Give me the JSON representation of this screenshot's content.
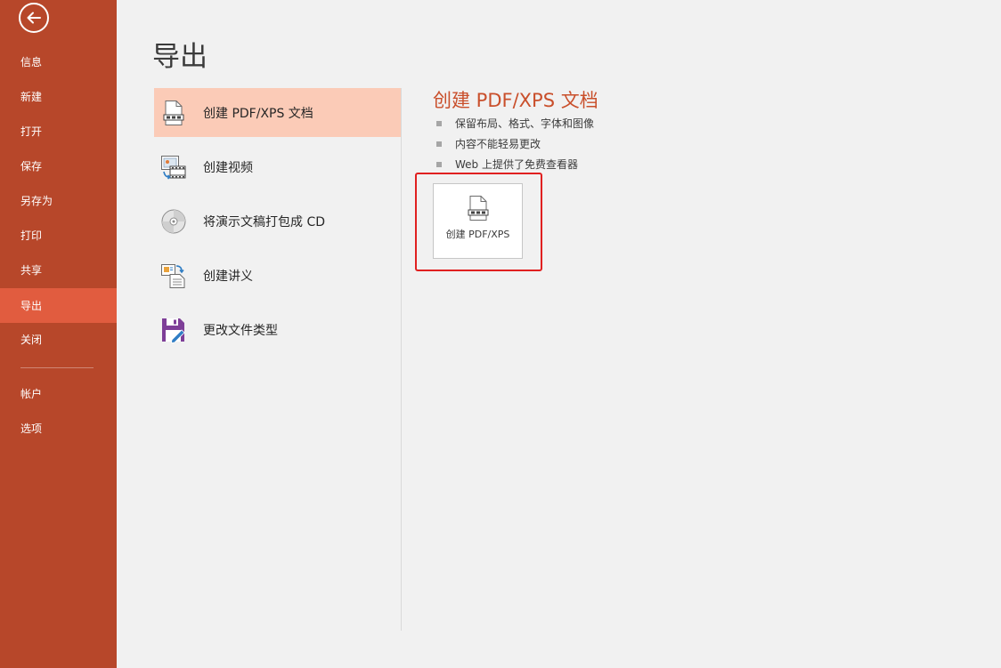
{
  "sidebar": {
    "back_icon": "back-arrow-icon",
    "items": [
      {
        "label": "信息"
      },
      {
        "label": "新建"
      },
      {
        "label": "打开"
      },
      {
        "label": "保存"
      },
      {
        "label": "另存为"
      },
      {
        "label": "打印"
      },
      {
        "label": "共享"
      },
      {
        "label": "导出",
        "active": true
      },
      {
        "label": "关闭"
      },
      {
        "label": "帐户"
      },
      {
        "label": "选项"
      }
    ]
  },
  "page": {
    "title": "导出"
  },
  "options": [
    {
      "label": "创建 PDF/XPS 文档",
      "icon": "pdf-document-icon",
      "selected": true
    },
    {
      "label": "创建视频",
      "icon": "video-icon"
    },
    {
      "label": "将演示文稿打包成 CD",
      "icon": "cd-icon"
    },
    {
      "label": "创建讲义",
      "icon": "handout-icon"
    },
    {
      "label": "更改文件类型",
      "icon": "change-file-type-icon"
    }
  ],
  "detail": {
    "title": "创建 PDF/XPS 文档",
    "bullets": [
      "保留布局、格式、字体和图像",
      "内容不能轻易更改",
      "Web 上提供了免费查看器"
    ],
    "button_label": "创建 PDF/XPS",
    "button_icon": "pdf-document-icon"
  },
  "colors": {
    "sidebar": "#b7472a",
    "sidebar_active": "#e15c3f",
    "option_selected": "#fbcbb7",
    "accent_title": "#c94f2b",
    "highlight_border": "#e02020"
  }
}
